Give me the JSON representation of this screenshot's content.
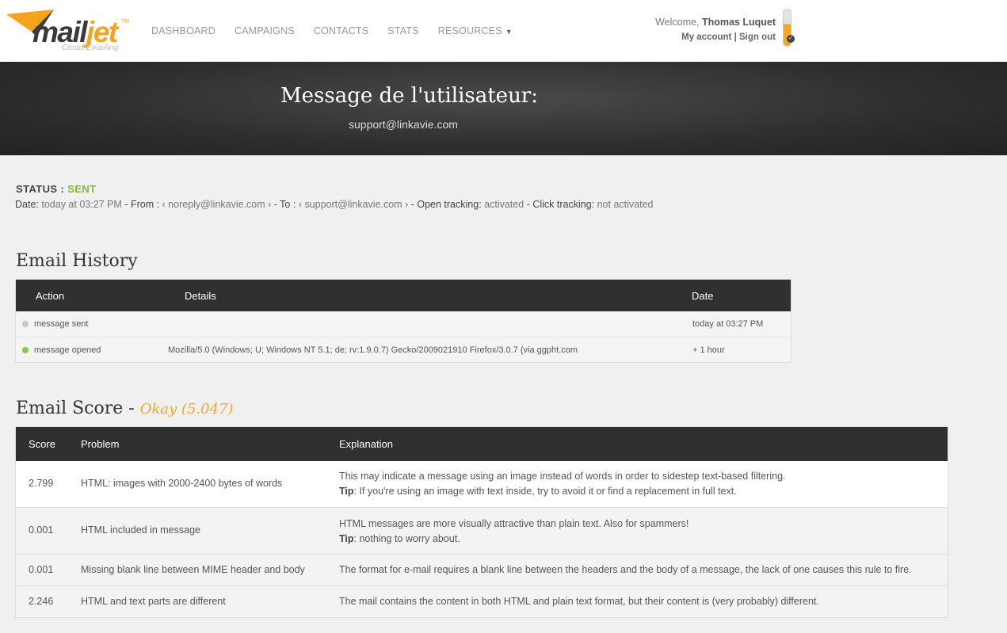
{
  "header": {
    "logo": {
      "main": "mail",
      "accent": "jet",
      "tm": "TM",
      "tagline": "Cloud Emailing"
    },
    "nav": [
      {
        "label": "DASHBOARD"
      },
      {
        "label": "CAMPAIGNS"
      },
      {
        "label": "CONTACTS"
      },
      {
        "label": "STATS"
      },
      {
        "label": "RESOURCES",
        "caret": "▼"
      }
    ],
    "user": {
      "welcome": "Welcome,",
      "name": "Thomas Luquet",
      "my_account": "My account",
      "separator": "|",
      "sign_out": "Sign out"
    }
  },
  "banner": {
    "title": "Message de l'utilisateur:",
    "email": "support@linkavie.com"
  },
  "status": {
    "label": "STATUS :",
    "value": "SENT",
    "date_label": "Date:",
    "date_value": "today at 03:27 PM",
    "from_label": "- From :",
    "from_value": "‹ noreply@linkavie.com ›",
    "to_label": "- To :",
    "to_value": "‹ support@linkavie.com ›",
    "open_label": "- Open tracking:",
    "open_value": "activated",
    "click_label": "- Click tracking:",
    "click_value": "not activated"
  },
  "history": {
    "title": "Email History",
    "columns": [
      "Action",
      "Details",
      "Date"
    ],
    "rows": [
      {
        "action": "message sent",
        "details": "",
        "date": "today at 03:27 PM",
        "dot_color": "#c8c8c8"
      },
      {
        "action": "message opened",
        "details": "Mozilla/5.0 (Windows; U; Windows NT 5.1; de; rv:1.9.0.7) Gecko/2009021910 Firefox/3.0.7 (via ggpht.com",
        "date": "+ 1 hour",
        "dot_color": "#8cc63f"
      }
    ]
  },
  "score": {
    "title": "Email Score -",
    "rating": "Okay (5.047)",
    "columns": [
      "Score",
      "Problem",
      "Explanation"
    ],
    "rows": [
      {
        "score": "2.799",
        "problem": "HTML: images with 2000-2400 bytes of words",
        "explanation": "This may indicate a message using an image instead of words in order to sidestep text-based filtering.",
        "tip_label": "Tip",
        "tip": ": If you're using an image with text inside, try to avoid it or find a replacement in full text."
      },
      {
        "score": "0.001",
        "problem": "HTML included in message",
        "explanation": "HTML messages are more visually attractive than plain text. Also for spammers!",
        "tip_label": "Tip",
        "tip": ": nothing to worry about."
      },
      {
        "score": "0.001",
        "problem": "Missing blank line between MIME header and body",
        "explanation": "The format for e-mail requires a blank line between the headers and the body of a message, the lack of one causes this rule to fire."
      },
      {
        "score": "2.246",
        "problem": "HTML and text parts are different",
        "explanation": "The mail contains the content in both HTML and plain text format, but their content is (very probably) different."
      }
    ]
  },
  "colors": {
    "accent": "#f5a623",
    "sent": "#7cba3a",
    "header_dark": "#303030"
  }
}
